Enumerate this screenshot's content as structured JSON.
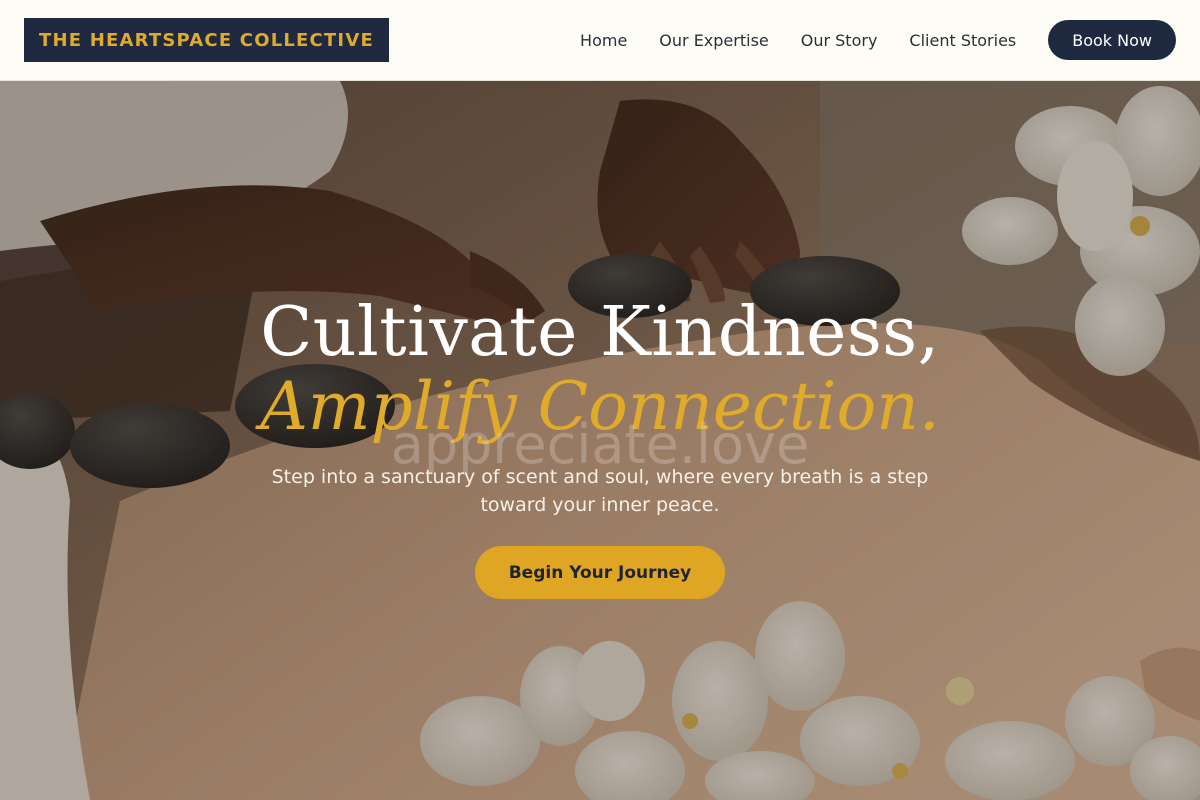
{
  "brand": {
    "name": "THE HEARTSPACE COLLECTIVE"
  },
  "nav": {
    "links": [
      "Home",
      "Our Expertise",
      "Our Story",
      "Client Stories"
    ],
    "cta_label": "Book Now"
  },
  "hero": {
    "headline_line1": "Cultivate Kindness,",
    "headline_line2": "Amplify Connection.",
    "watermark": "appreciate.love",
    "subtitle": "Step into a sanctuary of scent and soul, where every breath is a step toward your inner peace.",
    "cta_label": "Begin Your Journey",
    "image_subject": "hot-stone-massage-with-white-orchids"
  },
  "colors": {
    "navy": "#1f2940",
    "gold": "#dea623",
    "cream": "#fdfdf6",
    "white": "#ffffff"
  }
}
